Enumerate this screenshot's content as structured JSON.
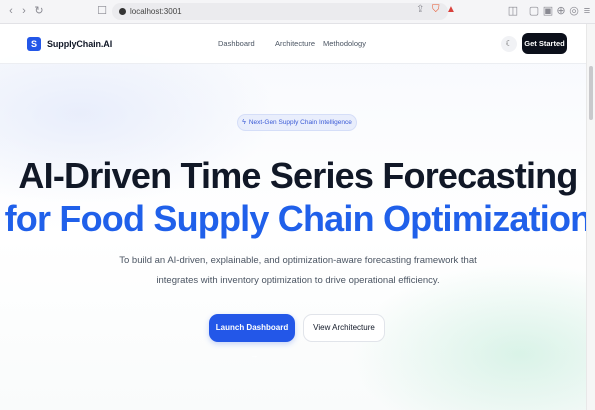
{
  "browser": {
    "url": "localhost:3001",
    "icons": [
      "back-icon",
      "forward-icon",
      "reload-icon",
      "bookmark-icon",
      "share-icon",
      "brave-shield-icon",
      "brave-rewards-icon",
      "sidebar-icon",
      "tabs-icon",
      "wallet-icon",
      "vpn-icon",
      "menu-icon"
    ]
  },
  "navbar": {
    "logo_letter": "S",
    "brand": "SupplyChain.AI",
    "links": [
      "Dashboard",
      "Architecture",
      "Methodology"
    ],
    "cta_label": "Get Started"
  },
  "hero": {
    "badge": "Next-Gen Supply Chain Intelligence",
    "title_line1": "AI-Driven Time Series Forecasting",
    "title_line2": "for Food Supply Chain Optimization",
    "subtitle_line1": "To build an AI-driven, explainable, and optimization-aware forecasting framework that",
    "subtitle_line2": "integrates with inventory optimization to drive operational efficiency.",
    "primary_button": "Launch Dashboard",
    "primary_arrow": "→",
    "secondary_button": "View Architecture"
  },
  "colors": {
    "accent": "#2357e8",
    "title_dark": "#111827",
    "title_blue": "#2060ea",
    "cta_dark": "#0b0f1a"
  }
}
